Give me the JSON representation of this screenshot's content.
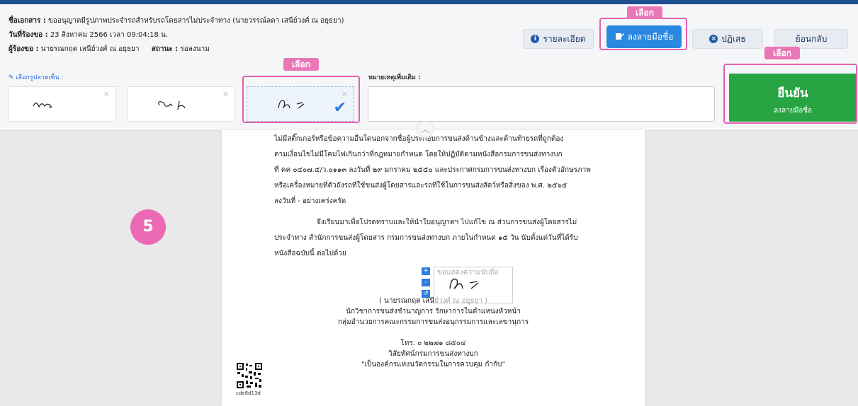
{
  "header": {
    "doc_label": "ชื่อเอกสาร :",
    "doc_name": "ขออนุญาตมีรูปภาพประจำรถสำหรับรถโดยสารไม่ประจำทาง (นายวรรณ์ลดา เสนีย์วงศ์ ณ อยุธยา)",
    "date_label": "วันที่ร้องขอ :",
    "date_value": "23 สิงหาคม 2566 เวลา 09:04:18 น.",
    "requester_label": "ผู้ร้องขอ :",
    "requester_value": "นายรณกฤต เสนีย์วงศ์ ณ อยุธยา",
    "status_label": "สถานะ :",
    "status_value": "รอลงนาม"
  },
  "toolbar": {
    "details_label": "รายละเอียด",
    "sign_label": "ลงลายมือชื่อ",
    "reject_label": "ปฏิเสธ",
    "back_label": "ย้อนกลับ"
  },
  "annotations": {
    "select_tag": "เลือก",
    "step_number": "5"
  },
  "signature": {
    "choose_label": "เลือกรูปลายเซ็น :",
    "close_glyph": "×",
    "note_label": "หมายเหตุเพิ่มเติม :",
    "note_value": "",
    "selected_index": 3
  },
  "confirm": {
    "main_label": "ยืนยัน",
    "sub_label": "ลงลายมือชื่อ"
  },
  "document": {
    "lines": [
      "ไม่มีสติ๊กเกอร์หรือข้อความอื่นใดนอกจากชื่อผู้ประกอบการขนส่งด้านข้างและด้านท้ายรถที่ถูกต้อง",
      "ตามเงื่อนไขไม่มีโคมไฟเกินกว่าที่กฎหมายกำหนด โดยให้ปฏิบัติตามหนังสือกรมการขนส่งทางบก",
      "ที่ คค ๐๔๐๗.๕/ว.๐๑๑๓ ลงวันที่ ๒๙ มกราคม ๒๕๕๐ และประกาศกรมการขนส่งทางบก เรื่องตัวอักษรภาพ",
      "หรือเครื่องหมายที่ตัวถังรถที่ใช้ขนส่งผู้โดยสารและรถที่ใช้ในการขนส่งสัตว์หรือสิ่งของ พ.ศ. ๒๕๖๕",
      "ลงวันที่ - อย่างเคร่งครัด"
    ],
    "para2": [
      "จึงเรียนมาเพื่อโปรดทราบและให้นำใบอนุญาตฯ ไปแก้ไข ณ ส่วนการขนส่งผู้โดยสารไม่",
      "ประจำทาง สำนักการขนส่งผู้โดยสาร กรมการขนส่งทางบก ภายในกำหนด ๑๕ วัน นับตั้งแต่วันที่ได้รับ",
      "หนังสือฉบับนี้ ต่อไปด้วย"
    ],
    "stamp_placeholder": "ขอแสดงความนับถือ",
    "signer_name": "( นายรณกฤต เสนีย์วงศ์ ณ อยุธยา )",
    "signer_title": "นักวิชาการขนส่งชำนาญการ รักษาการในตำแหน่งหัวหน้า",
    "signer_unit": "กลุ่มอำนวยการคณะกรรมการขนส่งอนุกรรมการและเลขานุการ",
    "phone": "โทร. ๐ ๒๒๗๑ ๘๕๐๔",
    "vision1": "วิสัยทัศน์กรมการขนส่งทางบก",
    "vision2": "\"เป็นองค์กรแห่งนวัตกรรมในการควบคุม กำกับ\"",
    "qr_code_text": "cde8d13d",
    "zoom_in": "+",
    "zoom_out": "-",
    "reset": "↺"
  }
}
